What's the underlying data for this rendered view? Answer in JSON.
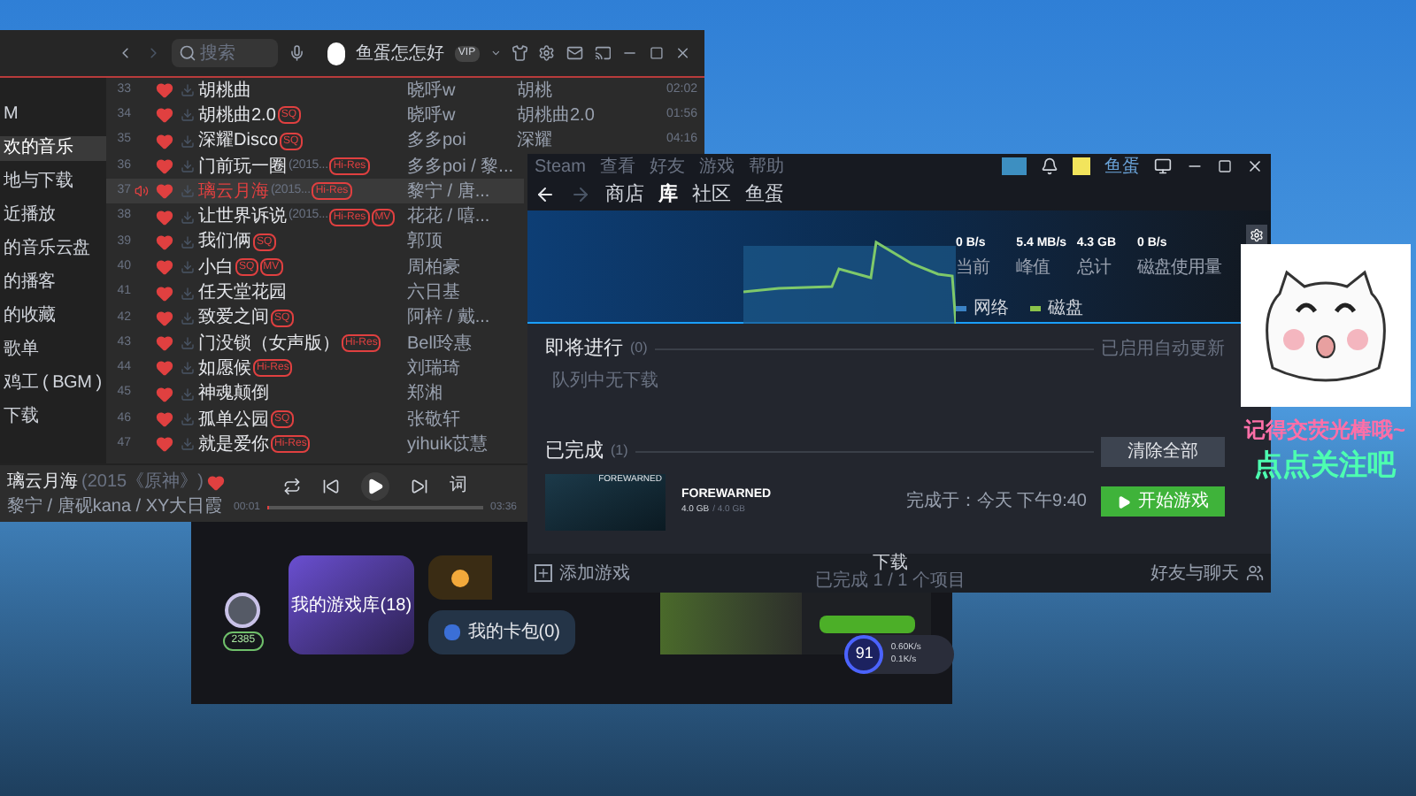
{
  "music_player": {
    "search": {
      "placeholder": "搜索"
    },
    "user": {
      "name": "鱼蛋怎怎好",
      "badge": "VIP"
    },
    "sidebar": [
      {
        "label": "M",
        "selected": false
      },
      {
        "label": "欢的音乐",
        "selected": true
      },
      {
        "label": "地与下载",
        "selected": false
      },
      {
        "label": "近播放",
        "selected": false
      },
      {
        "label": "的音乐云盘",
        "selected": false
      },
      {
        "label": "的播客",
        "selected": false
      },
      {
        "label": "的收藏",
        "selected": false
      },
      {
        "label": "歌单",
        "selected": false
      },
      {
        "label": "鸡工 ( BGM )",
        "selected": false
      },
      {
        "label": "下载",
        "selected": false
      }
    ],
    "tracks": [
      {
        "number": "33",
        "title": "胡桃曲",
        "artist": "晓呼w",
        "album": "胡桃",
        "duration": "02:02",
        "playing": false
      },
      {
        "number": "34",
        "title": "胡桃曲2.0",
        "tags": [
          "SQ"
        ],
        "artist": "晓呼w",
        "album": "胡桃曲2.0",
        "duration": "01:56",
        "playing": false
      },
      {
        "number": "35",
        "title": "深耀Disco",
        "tags": [
          "SQ"
        ],
        "artist": "多多poi",
        "album": "深耀",
        "duration": "04:16",
        "playing": false
      },
      {
        "number": "36",
        "title": "门前玩一圈",
        "subtitle": "(2015...",
        "tags": [
          "Hi-Res"
        ],
        "artist": "多多poi / 黎...",
        "playing": false
      },
      {
        "number": "37",
        "title": "璃云月海",
        "subtitle": "(2015...",
        "tags": [
          "Hi-Res"
        ],
        "artist": "黎宁 / 唐...",
        "playing": true
      },
      {
        "number": "38",
        "title": "让世界诉说",
        "subtitle": "(2015...",
        "tags": [
          "Hi-Res",
          "MV"
        ],
        "artist": "花花 / 嘻...",
        "playing": false
      },
      {
        "number": "39",
        "title": "我们俩",
        "tags": [
          "SQ"
        ],
        "artist": "郭顶",
        "playing": false
      },
      {
        "number": "40",
        "title": "小白",
        "tags": [
          "SQ",
          "MV"
        ],
        "artist": "周柏豪",
        "playing": false
      },
      {
        "number": "41",
        "title": "任天堂花园",
        "artist": "六日基",
        "playing": false
      },
      {
        "number": "42",
        "title": "致爱之间",
        "tags": [
          "SQ"
        ],
        "artist": "阿梓 / 戴...",
        "playing": false
      },
      {
        "number": "43",
        "title": "门没锁（女声版）",
        "tags": [
          "Hi-Res"
        ],
        "artist": "Bell玲惠",
        "playing": false
      },
      {
        "number": "44",
        "title": "如愿候",
        "tags": [
          "Hi-Res"
        ],
        "artist": "刘瑞琦",
        "playing": false
      },
      {
        "number": "45",
        "title": "神魂颠倒",
        "artist": "郑湘",
        "playing": false
      },
      {
        "number": "46",
        "title": "孤单公园",
        "tags": [
          "SQ"
        ],
        "artist": "张敬轩",
        "playing": false
      },
      {
        "number": "47",
        "title": "就是爱你",
        "tags": [
          "Hi-Res"
        ],
        "artist": "yihuik苡慧",
        "playing": false
      }
    ],
    "now_playing": {
      "title": "璃云月海",
      "subtitle": "(2015《原神》)",
      "artists": "黎宁 / 唐砚kana / XY大日霞",
      "elapsed": "00:01",
      "total": "03:36",
      "lyrics": "词",
      "level": 0.01
    }
  },
  "steam": {
    "menu": [
      "Steam",
      "查看",
      "好友",
      "游戏",
      "帮助"
    ],
    "account": "鱼蛋",
    "nav": [
      {
        "label": "商店",
        "selected": false
      },
      {
        "label": "库",
        "selected": true
      },
      {
        "label": "社区",
        "selected": false
      },
      {
        "label": "鱼蛋",
        "selected": false
      }
    ],
    "stats": [
      {
        "value": "0 B/s",
        "label": "当前"
      },
      {
        "value": "5.4 MB/s",
        "label": "峰值"
      },
      {
        "value": "4.3 GB",
        "label": "总计"
      },
      {
        "value": "0 B/s",
        "label": "磁盘使用量"
      }
    ],
    "legend": [
      {
        "label": "网络",
        "color": "#3b82c4"
      },
      {
        "label": "磁盘",
        "color": "#8bc34a"
      }
    ],
    "upcoming": {
      "title": "即将进行",
      "count": "(0)",
      "auto_update": "已启用自动更新",
      "empty": "队列中无下载"
    },
    "completed": {
      "title": "已完成",
      "count": "(1)",
      "clear": "清除全部"
    },
    "game": {
      "cover_title": "FOREWARNED",
      "name": "FOREWARNED",
      "size": "4.0 GB",
      "size_total": "/ 4.0 GB",
      "finished": "完成于：今天 下午9:40",
      "play": "开始游戏"
    },
    "footer": {
      "add": "添加游戏",
      "status_title": "下载",
      "status": "已完成 1 / 1 个项目",
      "friends": "好友与聊天"
    }
  },
  "launcher": {
    "badge": "2385",
    "library": "我的游戏库(18)",
    "cards": "我的卡包(0)",
    "speed": {
      "value": "91",
      "up": "0.60K/s",
      "down": "0.1K/s"
    }
  },
  "overlay": [
    {
      "text": "记得交荧光棒哦~",
      "color": "#ff6fa8"
    },
    {
      "text": "点点关注吧",
      "color": "#4dffb0"
    }
  ]
}
